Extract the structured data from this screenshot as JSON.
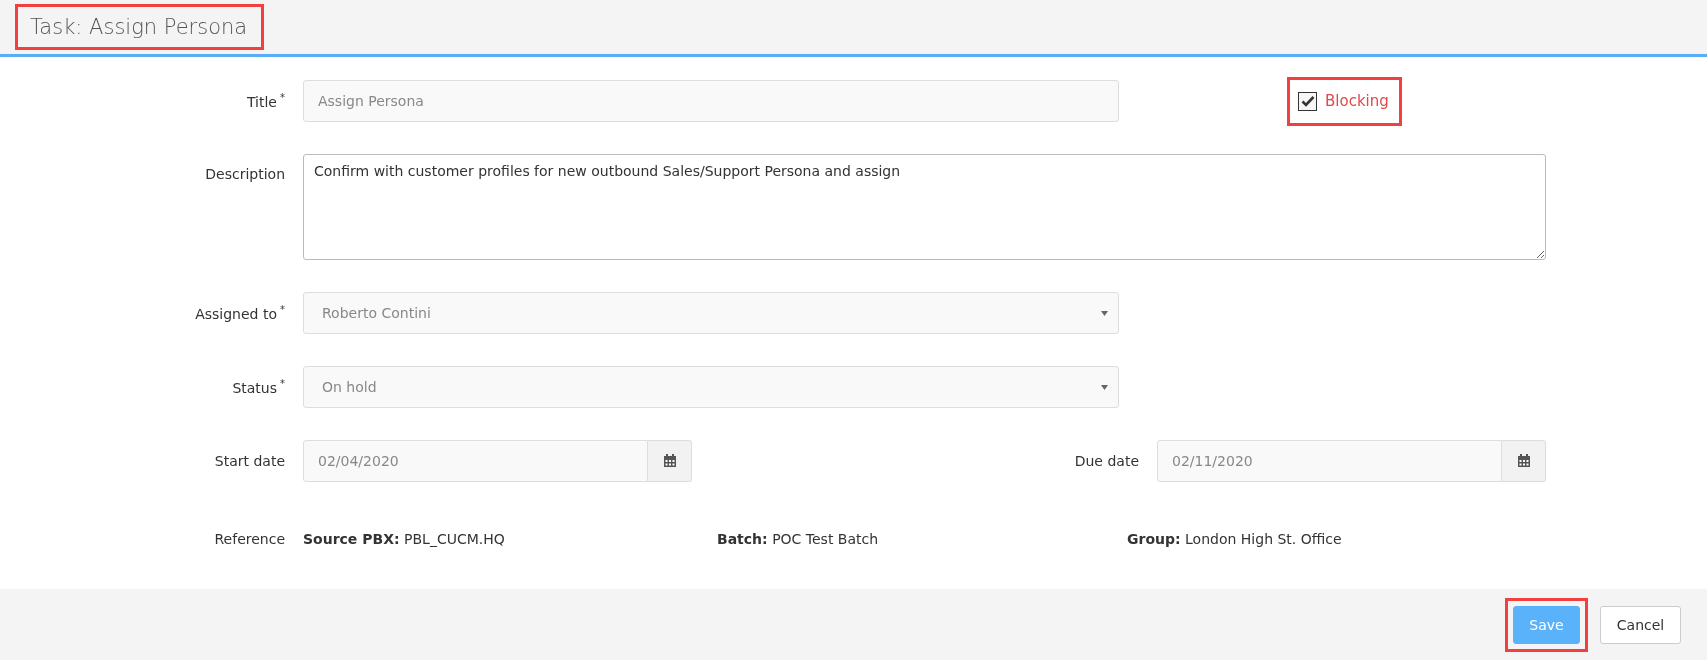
{
  "header": {
    "title": "Task: Assign Persona",
    "highlighted": true
  },
  "title_field": {
    "label": "Title",
    "required_mark": "*",
    "value": "Assign Persona"
  },
  "blocking": {
    "label": "Blocking",
    "checked": true,
    "highlighted": true
  },
  "description": {
    "label": "Description",
    "value": "Confirm with customer profiles for new outbound Sales/Support Persona and assign"
  },
  "assigned_to": {
    "label": "Assigned to",
    "required_mark": "*",
    "value": "Roberto Contini"
  },
  "status": {
    "label": "Status",
    "required_mark": "*",
    "value": "On hold"
  },
  "start_date": {
    "label": "Start date",
    "value": "02/04/2020"
  },
  "due_date": {
    "label": "Due date",
    "value": "02/11/2020"
  },
  "reference": {
    "label": "Reference",
    "items": [
      {
        "text": "**Source PBX:** PBL_CUCM.HQ"
      },
      {
        "text": "**Batch:** POC Test Batch"
      },
      {
        "text": "**Group:** London High St. Office"
      }
    ]
  },
  "buttons": [
    {
      "label": "Save",
      "kind": "primary",
      "highlighted": true
    },
    {
      "label": "Cancel",
      "kind": "default",
      "highlighted": false
    }
  ]
}
